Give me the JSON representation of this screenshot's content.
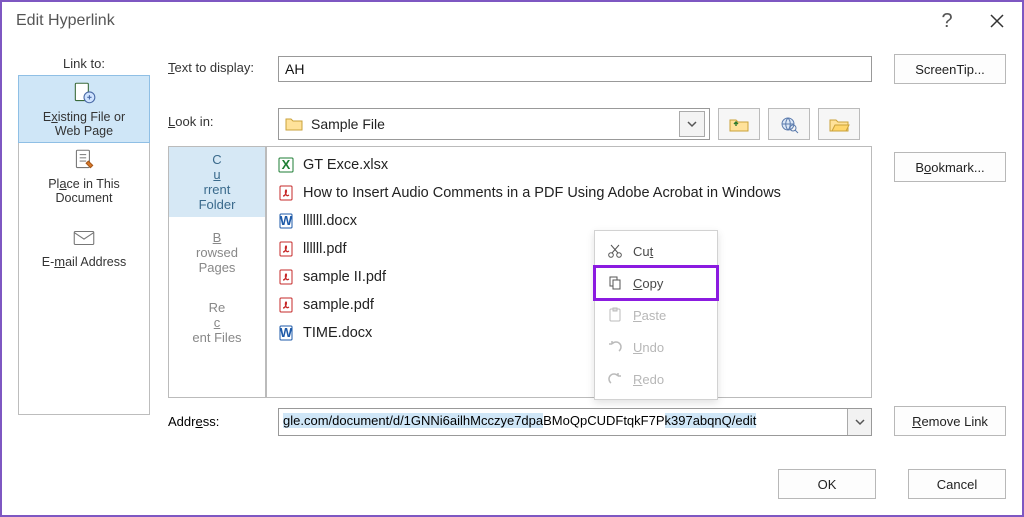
{
  "window": {
    "title": "Edit Hyperlink"
  },
  "link_to": {
    "label": "Link to:",
    "items": [
      {
        "text": "Existing File or Web Page",
        "accel": "x",
        "selected": true
      },
      {
        "text": "Place in This Document",
        "accel": "A"
      },
      {
        "text": "E-mail Address",
        "accel": "m"
      }
    ]
  },
  "text_to_display": {
    "label": "Text to display:",
    "accel": "T",
    "value": "AH"
  },
  "screentip": {
    "label": "ScreenTip..."
  },
  "look_in": {
    "label": "Look in:",
    "accel": "L",
    "value": "Sample File"
  },
  "mid_tabs": [
    {
      "line1": "Current",
      "accel": "u",
      "line2": "Folder",
      "selected": true
    },
    {
      "line1": "Browsed",
      "accel": "B",
      "line2": "Pages"
    },
    {
      "line1": "Recent",
      "accel": "c",
      "postfix": " Files",
      "line2": ""
    }
  ],
  "files": [
    {
      "name": "GT Exce.xlsx",
      "type": "xlsx"
    },
    {
      "name": "How to Insert Audio Comments in a PDF Using Adobe Acrobat in Windows",
      "type": "pdf"
    },
    {
      "name": "llllll.docx",
      "type": "docx"
    },
    {
      "name": "llllll.pdf",
      "type": "pdf"
    },
    {
      "name": "sample II.pdf",
      "type": "pdf"
    },
    {
      "name": "sample.pdf",
      "type": "pdf"
    },
    {
      "name": "TIME.docx",
      "type": "docx"
    }
  ],
  "context_menu": {
    "cut": {
      "label": "Cut",
      "accel": "t",
      "enabled": true
    },
    "copy": {
      "label": "Copy",
      "accel": "C",
      "enabled": true,
      "highlighted": true
    },
    "paste": {
      "label": "Paste",
      "accel": "P",
      "enabled": false
    },
    "undo": {
      "label": "Undo",
      "accel": "U",
      "enabled": false
    },
    "redo": {
      "label": "Redo",
      "accel": "R",
      "enabled": false
    }
  },
  "bookmark": {
    "label": "Bookmark..."
  },
  "address": {
    "label": "Address:",
    "accel": "e",
    "prefix": "gle.com/document/d/1GNNi6ailhMcczye7dpa",
    "covered": "BMoQpCUDFtqkF7P",
    "suffix": "k397abqnQ/edit"
  },
  "remove_link": {
    "label": "Remove Link",
    "accel": "R"
  },
  "ok": {
    "label": "OK"
  },
  "cancel": {
    "label": "Cancel"
  },
  "colors": {
    "highlight": "#8b1be0"
  }
}
